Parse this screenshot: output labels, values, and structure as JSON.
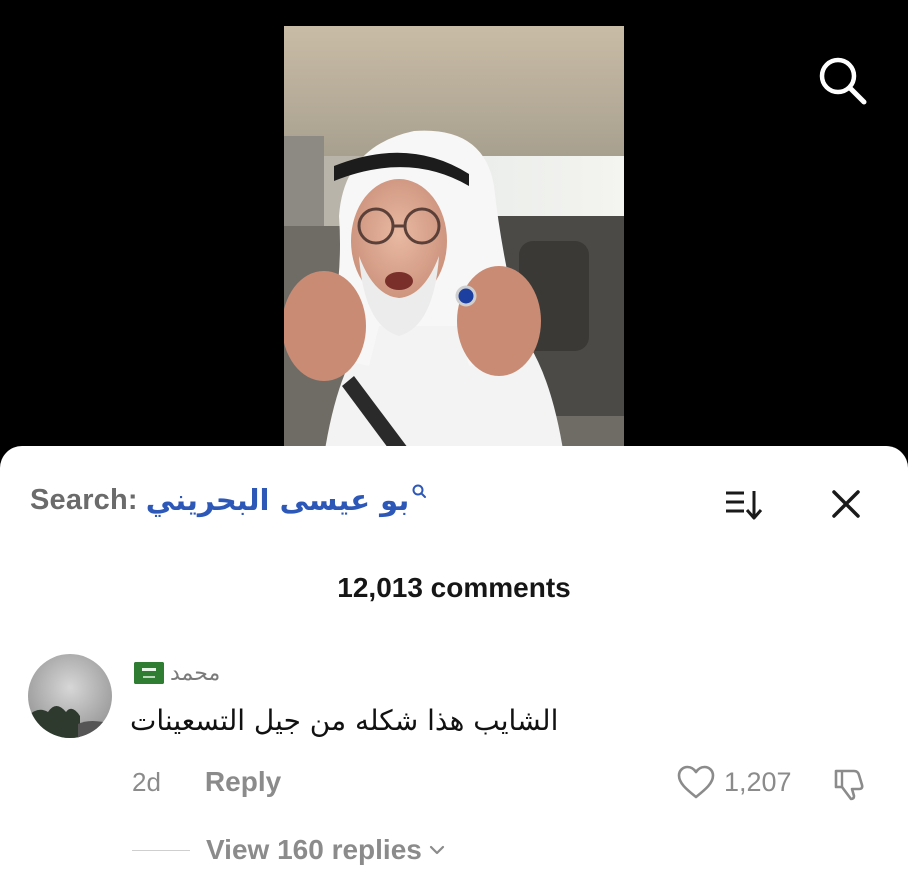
{
  "video": {
    "description_icon": "person-video-thumbnail"
  },
  "top_bar": {
    "search_icon": "search-icon"
  },
  "comments_sheet": {
    "search_prefix": "Search:",
    "search_term": "بو عيسى البحريني",
    "sort_icon": "sort-icon",
    "close_icon": "close-icon",
    "comment_count": "12,013 comments"
  },
  "comments": [
    {
      "username": "محمد",
      "flag": "saudi-flag",
      "text": "الشايب هذا شكله من جيل التسعينات",
      "time": "2d",
      "reply_label": "Reply",
      "likes": "1,207",
      "view_replies": "View 160 replies"
    }
  ],
  "colors": {
    "search_term": "#2d58b8",
    "muted": "#8b8b8b",
    "text": "#111111",
    "background": "#000000",
    "sheet": "#ffffff"
  }
}
